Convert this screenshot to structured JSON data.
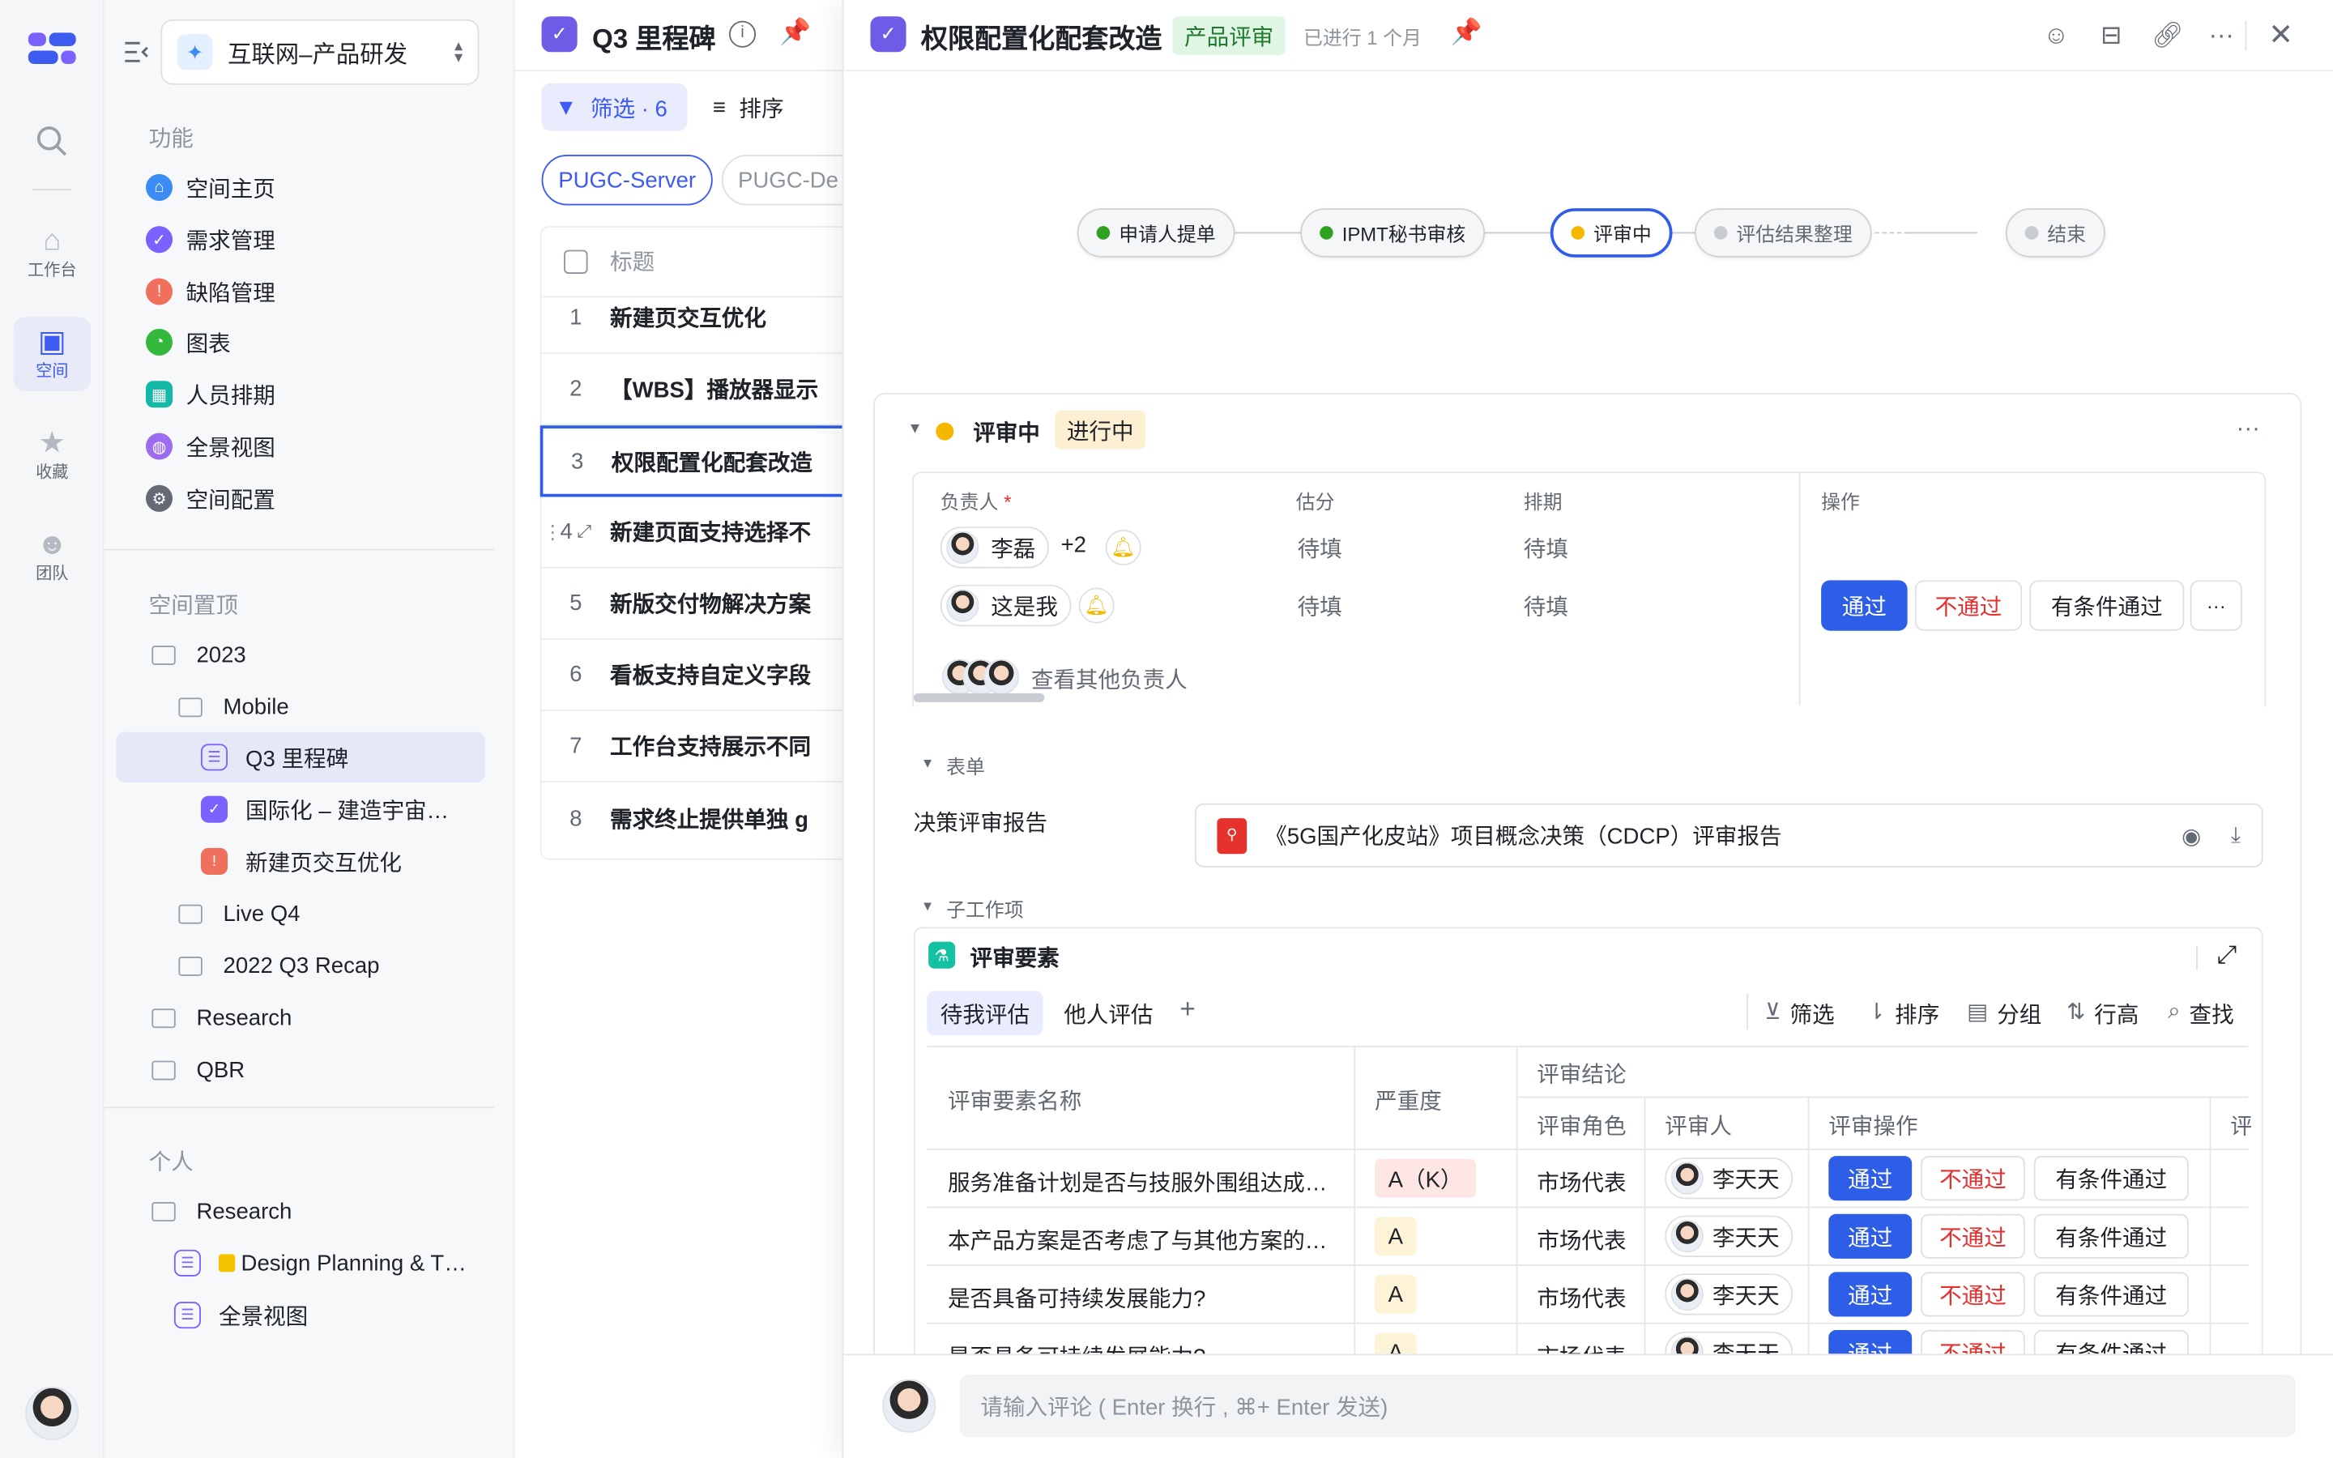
{
  "rail": {
    "items": [
      {
        "label": "工作台",
        "icon": "home-icon"
      },
      {
        "label": "空间",
        "icon": "space-icon"
      },
      {
        "label": "收藏",
        "icon": "star-icon"
      },
      {
        "label": "团队",
        "icon": "team-icon"
      }
    ]
  },
  "nav": {
    "workspace": "互联网–产品研发",
    "features_title": "功能",
    "features": [
      "空间主页",
      "需求管理",
      "缺陷管理",
      "图表",
      "人员排期",
      "全景视图",
      "空间配置"
    ],
    "pinned_title": "空间置顶",
    "tree": [
      "2023",
      "Mobile",
      "Q3 里程碑",
      "国际化 – 建造宇宙…",
      "新建页交互优化",
      "Live Q4",
      "2022 Q3 Recap",
      "Research",
      "QBR"
    ],
    "personal_title": "个人",
    "personal": [
      "Research",
      "Design Planning & T…",
      "全景视图"
    ]
  },
  "list": {
    "title": "Q3 里程碑",
    "filter": "筛选 · 6",
    "sort": "排序",
    "chips": [
      "PUGC-Server",
      "PUGC-De"
    ],
    "col_title": "标题",
    "rows": [
      {
        "n": "1",
        "t": "新建页交互优化"
      },
      {
        "n": "2",
        "t": "【WBS】播放器显示"
      },
      {
        "n": "3",
        "t": "权限配置化配套改造"
      },
      {
        "n": "4",
        "t": "新建页面支持选择不"
      },
      {
        "n": "5",
        "t": "新版交付物解决方案"
      },
      {
        "n": "6",
        "t": "看板支持自定义字段"
      },
      {
        "n": "7",
        "t": "工作台支持展示不同"
      },
      {
        "n": "8",
        "t": "需求终止提供单独 g"
      }
    ]
  },
  "detail": {
    "title": "权限配置化配套改造",
    "tag": "产品评审",
    "elapsed": "已进行 1 个月",
    "flow": [
      "申请人提单",
      "IPMT秘书审核",
      "评审中",
      "评估结果整理",
      "结束"
    ],
    "stage": {
      "name": "评审中",
      "status": "进行中",
      "cols": [
        "负责人",
        "估分",
        "排期",
        "操作"
      ],
      "required": "*",
      "assignees": [
        {
          "name": "李磊",
          "extra": "+2",
          "score": "待填",
          "sched": "待填"
        },
        {
          "name": "这是我",
          "extra": "",
          "score": "待填",
          "sched": "待填"
        }
      ],
      "actions": {
        "pass": "通过",
        "fail": "不通过",
        "cond": "有条件通过"
      },
      "others": "查看其他负责人"
    },
    "form": {
      "title": "表单",
      "label": "决策评审报告",
      "file": "《5G国产化皮站》项目概念决策（CDCP）评审报告"
    },
    "sub": {
      "title": "子工作项",
      "card_title": "评审要素",
      "tabs": [
        "待我评估",
        "他人评估"
      ],
      "tools": [
        "筛选",
        "排序",
        "分组",
        "行高",
        "查找"
      ],
      "head": {
        "name": "评审要素名称",
        "sev": "严重度",
        "conclusion": "评审结论",
        "role": "评审角色",
        "reviewer": "评审人",
        "op": "评审操作",
        "more": "评"
      },
      "rows": [
        {
          "name": "服务准备计划是否与技服外围组达成…",
          "sev": "A（K）",
          "role": "市场代表",
          "reviewer": "李天天"
        },
        {
          "name": "本产品方案是否考虑了与其他方案的…",
          "sev": "A",
          "role": "市场代表",
          "reviewer": "李天天"
        },
        {
          "name": "是否具备可持续发展能力?",
          "sev": "A",
          "role": "市场代表",
          "reviewer": "李天天"
        },
        {
          "name": "是否具备可持续发展能力?",
          "sev": "A",
          "role": "市场代表",
          "reviewer": "李天天"
        }
      ]
    },
    "comment_placeholder": "请输入评论 ( Enter 换行 , ⌘+ Enter 发送)"
  },
  "colors": {
    "brand": "#3d5af1",
    "primary": "#2e5de8",
    "danger": "#e52e2e",
    "warn": "#f5b800",
    "green": "#2ea121"
  }
}
